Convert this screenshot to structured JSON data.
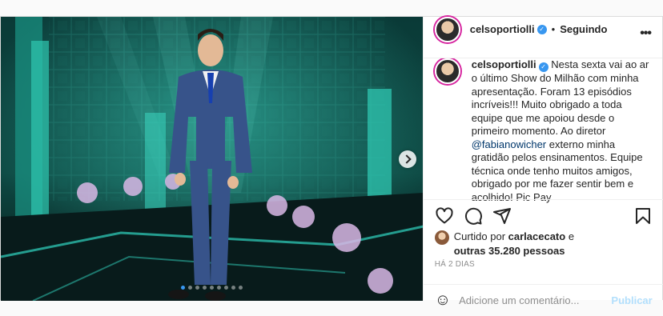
{
  "post": {
    "username": "celsoportiolli",
    "follow_separator": "•",
    "follow_status": "Seguindo",
    "more_icon": "more-horizontal-icon",
    "caption_user": "celsoportiolli",
    "caption_part1": "Nesta sexta vai ao ar o último Show do Milhão com minha apresentação. Foram 13 episódios incríveis!!! Muito obrigado a toda equipe que me apoiou desde o primeiro momento. Ao diretor",
    "caption_mention": "@fabianowicher",
    "caption_part2": "externo minha gratidão pelos ensinamentos. Equipe técnica onde tenho muitos amigos, obrigado por me fazer sentir bem e acolhido! Pic Pay",
    "likes_prefix": "Curtido por",
    "likes_user": "carlacecato",
    "likes_conj": "e",
    "likes_others": "outras 35.280 pessoas",
    "timestamp": "Há 2 dias",
    "comment_placeholder": "Adicione um comentário...",
    "publish_label": "Publicar",
    "carousel": {
      "total": 9,
      "active_index": 0
    }
  },
  "colors": {
    "accent": "#3897f0",
    "mention": "#00376b",
    "publish_disabled": "#b2dffc"
  }
}
